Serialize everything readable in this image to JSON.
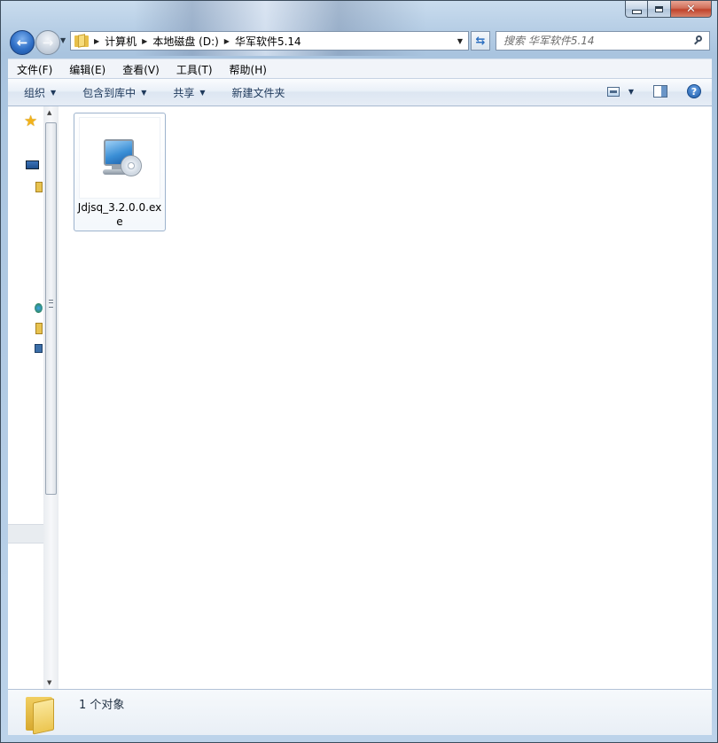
{
  "window": {
    "buttons": {
      "minimize": "minimize",
      "maximize": "maximize",
      "close": "✕"
    }
  },
  "address": {
    "breadcrumbs": [
      "计算机",
      "本地磁盘 (D:)",
      "华军软件5.14"
    ]
  },
  "search": {
    "placeholder": "搜索 华军软件5.14"
  },
  "menu": {
    "items": [
      "文件(F)",
      "编辑(E)",
      "查看(V)",
      "工具(T)",
      "帮助(H)"
    ]
  },
  "commands": {
    "organize": "组织",
    "include_library": "包含到库中",
    "share": "共享",
    "new_folder": "新建文件夹"
  },
  "files": [
    {
      "name": "Jdjsq_3.2.0.0.exe",
      "icon": "setup-monitor-disc-icon"
    }
  ],
  "details": {
    "count_text": "1 个对象"
  },
  "icons": {
    "back": "back-arrow-icon",
    "forward": "forward-arrow-icon",
    "refresh": "refresh-icon",
    "search": "search-icon",
    "help": "help-icon",
    "favorites": "star-icon"
  },
  "colors": {
    "accent": "#2f6fc6",
    "command_text": "#1e395b",
    "selection_border": "#9db3cd"
  }
}
